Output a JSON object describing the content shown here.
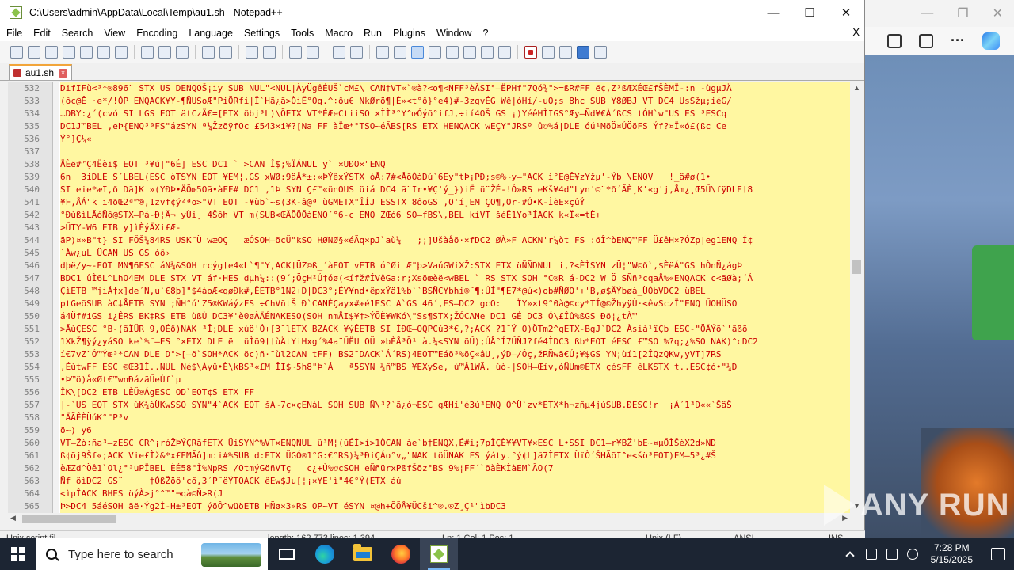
{
  "window": {
    "title": "C:\\Users\\admin\\AppData\\Local\\Temp\\au1.sh - Notepad++",
    "minimize": "—",
    "maximize": "☐",
    "close": "✕"
  },
  "menu": [
    "File",
    "Edit",
    "Search",
    "View",
    "Encoding",
    "Language",
    "Settings",
    "Tools",
    "Macro",
    "Run",
    "Plugins",
    "Window",
    "?"
  ],
  "menu_close": "X",
  "tab": {
    "label": "au1.sh",
    "close": "×"
  },
  "editor": {
    "lines": [
      {
        "n": "532",
        "t": "DifIFù<³*®896¨ STX US DENQOŠ¡iy SUB NUL\"<NUL|ÀyÜgêÉUŠ`cM£\\ CAN†VT«`®à?<o¶<NFF³èÀSI°–ËPHf\"7Qó¾\">=ßR#FF ë¢,Z³ßÆXÉŒ£fŠÈMÏ-:n -ùgµJÄ"
      },
      {
        "n": "533",
        "t": "(ô¢@Ê ·e*/!ÓP ENQACK¥Y-¶ÑUSoÆ\"PiÕRfi|Ï`Hä¿ã>ÒiË°Og.^÷ôu€ NkØrö¶|È»<t°ô}°e4)#-3zgvÉG Wê|óHí/-uO;s 8hc SUB Y8ØBJ VT DC4 UsSžµ;iéG/"
      },
      {
        "n": "534",
        "t": "…DBY:¿´(cvó SI LGS EOT ätCzÄ€=[ETX öbj³L)\\ÕETX VT*ÉÆeCtiiSO ×ÌÌ³°Y^œÓýõ°ifJ,÷ií4OŠ GS ¡)YéêHÌIGS°Æy–Ñd¥€À´ßCS tÓH`w\"US ES ³ESCq"
      },
      {
        "n": "535",
        "t": "DC1J™BEL ,eÞ{ENQ³ªFS\"ázSYN ª¼ŽzõÿfOc £543×i¥?[Na FF àÏœ*°TSO~éÃBS[RS ETX HENQACK wEÇY\"JRSº û©%á|DLE óú¹MõÖ¤ÚÖöFS Ýf?¤Ï«ó£(ßc Ce"
      },
      {
        "n": "536",
        "t": "Ý°]Ç¼«"
      },
      {
        "n": "537",
        "t": ""
      },
      {
        "n": "538",
        "t": "ÄÈë#™Ç4Ëèi$ EOT ³¥ú|\"6É] ESC DC1 ` >CAN Î$;%ÏÁNUL y`¯×UÐO×\"ENQ"
      },
      {
        "n": "539",
        "t": "6n  3iDLE S´LBEL(ESC òTSYN EOT ¥EM¦,GS xWØ:9äÅ*±;«ÞÝêxÝSTX òÅ:7#<ÅõÒàDú`6Ey\"tÞ¡PÐ;s©%~y—\"ACK ì°E@Ê¥zYžµ'-Ýb \\ENQV   !_ä#ø(1•"
      },
      {
        "n": "540",
        "t": "SI eie*æI,ð Dã]K »(YÐÞ•ÄÕœ5Oã•àFF# DC1 ,1Þ SYN Ç£™«ünOUS üiá DC4 ã¨Ir•¥Ç'ý_})iË ü¨ŽÉ-!Ó»RS eKš¥4d\"Lyn'©¨*ð´ÃÈ¸K'«g'j,Åm¿¸Œ5Ü\\fÿDLE†8"
      },
      {
        "n": "541",
        "t": "¥F,ÅÁ\"k¨i4ðŒ2ª™®,1zvf¢ý²ªo>\"VT EOT -¥ùb`~s(3K-â@ª ùGMETX\"ÎÍJ ESSTX 8ôoGS ,O'í]EM ÇO¶,Or-#Ó•K-ÌèE×çûÝ"
      },
      {
        "n": "542",
        "t": "°ÐùßìLÃóÑô@STX–Pá-Ð¦Ä¬ yÙi¸ 4Šôh VT m(SUB<ŒÄÕÕÕàENQ´°6-c ENQ ZŒó6 SO–fBS\\,BEL kíVT šéË1Yo³ÍACK k«Ï«=tÈ+"
      },
      {
        "n": "543",
        "t": ">ÜTY-W6 ETB y]ìÈýÄXi£Æ-"
      },
      {
        "n": "544",
        "t": "äP)¤»B\"t} SI FÖŠ¼84RS USK¨Ü wæOÇ   æÓSOH–õcÜ\"kSO HØNØ§«éÃq×pJ`aù¼   ;;]Ušàåõ·×fDC2 ØÀ»F ACKN'r¼òt FS :öÎ^òENQ™FF Ü£êH×?ÓZp|eg1ENQ Í¢"
      },
      {
        "n": "545",
        "t": "`Àw¿uL ÜCAN US GS óô›"
      },
      {
        "n": "546",
        "t": "dþë/y~-EOT MN¶6ESC áN¾&SOH rcýg†e4«L`¶\"Y,ACK†ÜZ©ß_´àEOT vETB ó°Øi Æ\"þ>VaúGWiXŽ:STX ETX öÑÑDNUL i,?<ÈÌSYN zÜ¦\"W©ð`,$ÈëÁ\"GS hÒnÑ¿ágÞ"
      },
      {
        "n": "547",
        "t": "BDC1 ûÌ6L^LhO4EM DLE STX VT áf·HES dµh¼::(9´;ÖçH²Ú†óø(<ífž#ÍVêGa:r;Xsõœèë<wBEL ` RS STX SOH °C®R_á-DC2 W Ö_SÑñ³cqaÅ%«ENQACK c<ãØà;´Á"
      },
      {
        "n": "548",
        "t": "ÇìETB ™jiÁ†x]de´N,u`€8þ]\"$4àoÆ<qøÐk#,ÊETB°1N2+D|DC3°;ÉY¥nd•ëpxÝä1%b``BSÑCYbhi®¨¶:ÚÍ\"¶E7*@ú<)ob#ÑØO'+'B,ø$ÄÝbøà_ÜÒbVDC2 üBEL"
      },
      {
        "n": "549",
        "t": "ptGeõSUB àC‡ÅETB SYN ;ÑH°ú\"Z5®KWáýzFS ÷ChVñtŠ Ð`CANÈÇayx#æé1ESC A`GS 46´,ES–DC2 gcO:   ÏY»×t9°0à@©cy*TÍ@©ŽhyÿÙ·<êvSczÏ\"ENQ ÜOHÜSO"
      },
      {
        "n": "550",
        "t": "á4Üf#iGS i¿ÊRS BK‡RS ETB ùßÙ_DC3¥'è0øÀÄÉNAKESO(SOH nmÅI$¥†>ÝÕÈ¥WKó\\\"Ss¶STX;ŽÓCANe DC1 GÉ DC3 Ó\\£Îû%ßGS Ðð¦¿tÀ™"
      },
      {
        "n": "551",
        "t": ">ÃùÇESC °B-(ãÏÜR 9,OÉð)NAK ³Î;DLE xùö'Ó+[3¯lETX BZACK ¥ýÉETB SI ÌÐŒ–OQPCú3*€,?;ACK ?1¯Ý O)ÖTm2^qETX-BgJ`DC2 Àsià¹ïÇb ESC-\"ÖÄÝõ`'ãßõ"
      },
      {
        "n": "552",
        "t": "1XkŽ¶ÿý¿yáSO ke`%¨–ES °×ETX DLE ë  üÌõ9††ùÄtYiHxg´%4a¨ÜËU OÜ »bÈÅ³Õ¹ à.¼<SYN öÜ);ÚÅ°Í7ÜÑJ?fé4ÌDC3 ßb*EOT éESC £™SO %?q;¿%SO NAK)^cDC2"
      },
      {
        "n": "553",
        "t": "í€7vZ¨Ó™Ýœ³*CAN DLE D°>[—ð`SOH*ACK öc)ñ·¯ùl2CAN tFF) BS2¯DACK`Á´RS)4EOT™Eáõ³%õÇ«âU¸,ýD–/Óç,žRÑwã€Ú;¥$GS YN;ùí1[2ÎQzQKw,yVT]7RS"
      },
      {
        "n": "554",
        "t": ",ÉùtwFF ESC ©Œ31Ì..NUL Né$\\Àyû•È\\kBS³«£M ÎI$~5h8\"Þ`Á   ª5SYN ¼ñ™BS ¥EXySe, ù™Â1WÃ. ùò-|SOH–Œív,óÑUm©ETX çé$FF êLKSTX t..ESC¢ó•\"¼D"
      },
      {
        "n": "555",
        "t": "•Þ™ö)å«Øt€™wnÐázãÜeÙf`µ"
      },
      {
        "n": "556",
        "t": "ÎK\\[DC2 ETB LÈÜ®ÁgESC OD`EOT¢S ETX FF"
      },
      {
        "n": "557",
        "t": "|-`US EOT STX ùK¾àÜKwSSO SYN\"4`ACK EOT šA~7c×çENàL SOH SUB Ñ\\³?`ã¿ó¬ESC gÆHí'é3ú³ENQ Ó^Ü`zv*ETX*h¬zñµ4júSUB.ÐESC!r  ¡Á´1³D««`ŠäŠ"
      },
      {
        "n": "558",
        "t": "\"ÄÃÊÈÜúK°\"P³v"
      },
      {
        "n": "559",
        "t": "ö~) y6"
      },
      {
        "n": "560",
        "t": "VT–Žò÷ña³–zESC CR^¡róŽÞÝÇRãfETX ÜiSYN^%VT×ENQNUL û³M¦(ûÉÌ>í>1ÒCAN àe`b†ENQX,É#i;7pÌÇÈ¥¥VT¥×ESC L•SSI DC1–r¥BŽ'bE~¤µÖÌŠèX2d»ND"
      },
      {
        "n": "561",
        "t": "ß¢õj9Šf«;ACK Vie£Ìž&*x£EMÃô]m:i#%SUB d:ETX ÜGÓ®1°G:€°RS)¼³ÐiÇÁo°v„\"NAK töÜNAK FS ýáty.°ý¢L]ä7ÌETX ÜïÒ´ŠHÃõI^e<šö³EOT)EM–5³¿#Š"
      },
      {
        "n": "562",
        "t": "èÆZd^Öê1`Ol¿°³uPÏBEL ÈÉ58\"Ì%NpRS /OtmýGöñVTç   c¿+Ù%©cSOH eÑñürxPßfŠõz°BS 9%¦FF´`ðàÈKÌàEM`ÃO(7"
      },
      {
        "n": "563",
        "t": "Ñf öìDC2 GS¨     †ÓßŽöö'cõ,3´P¨ëÝTOACK êEw$Ju[¦¡×YE'ì\"4€°Ý(ETX áú"
      },
      {
        "n": "564",
        "t": "<ìµÎACK BHES öýÀ>j°^™\"¬qà©Ñ>R(J"
      },
      {
        "n": "565",
        "t": "Þ>DC4 5áéSOH ãë·Ýg2Ì-H±³EOT ýõÔ^wüöETB HÑø×3«RS OP~VT éSYN ¤@h+ÕÕÅ¥ÜCši^®.®Z¸Ç¹\"ìbDC3"
      }
    ]
  },
  "statusbar": {
    "file_type": "Unix script fil",
    "length": "length: 162,773  lines: 1,394",
    "position": "Ln: 1  Col: 1  Pos: 1",
    "eol": "Unix (LF)",
    "encoding": "ANSI",
    "mode": "INS"
  },
  "watermark": "ANY RUN",
  "taskbar": {
    "search_placeholder": "Type here to search",
    "time": "7:28 PM",
    "date": "5/15/2025"
  },
  "colors": {
    "selection_bg": "#fff7a1",
    "text_red": "#cc0000",
    "tab_accent": "#f2a53a",
    "taskbar_bg": "#1c2533"
  }
}
